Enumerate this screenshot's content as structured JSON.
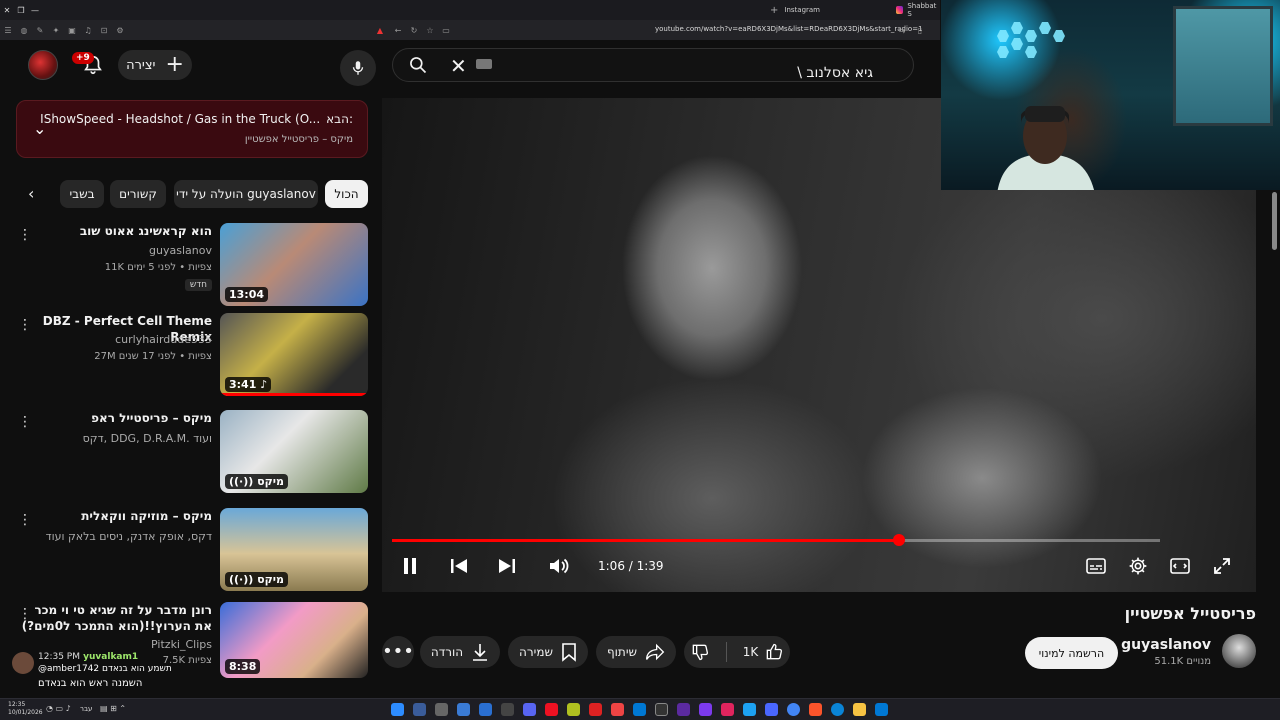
{
  "browser": {
    "tabs": [
      {
        "label": "Instagram"
      },
      {
        "label": "Shabbat S"
      }
    ],
    "url": "youtube.com/watch?v=eaRD6X3DjMs&list=RDeaRD6X3DjMs&start_radio=1"
  },
  "header": {
    "notification_count": "+9",
    "create_label": "יצירה",
    "search_query": "גיא אסלנוב \\"
  },
  "up_next": {
    "title": "IShowSpeed - Headshot / Gas in the Truck (O...",
    "prefix": "הבא:",
    "subtitle": "מיקס – פריסטייל אפשטיין"
  },
  "chips": [
    "הכול",
    "הועלה על ידי guyaslanov",
    "קשורים",
    "בשבי"
  ],
  "videos": [
    {
      "title": "הוא קראשינג אאוט שוב",
      "channel": "guyaslanov",
      "meta": "11K צפיות • לפני 5 ימים",
      "badge": "חדש",
      "duration": "13:04"
    },
    {
      "title": "DBZ - Perfect Cell Theme Remix",
      "channel": "curlyhairdude535",
      "meta": "27M צפיות • לפני 17 שנים",
      "duration": "3:41"
    },
    {
      "title": "מיקס – פריסטייל ראפ",
      "channel": "דקס, DDG, D.R.A.M. ועוד",
      "duration": "מיקס"
    },
    {
      "title": "מיקס – מוזיקה ווקאלית",
      "channel": "דקס, אופק אדנק, ניסים בלאק ועוד",
      "duration": "מיקס"
    },
    {
      "title": "רונן מדבר על זה שגיא טי וי מכר את הערוץ!!(הוא התמכר ל0מים?)",
      "channel": "Pitzki_Clips",
      "meta": "7.5K צפיות",
      "duration": "8:38"
    }
  ],
  "player": {
    "current_time": "1:06",
    "total_time": "1:39",
    "time_display": "1:06 / 1:39",
    "progress_fraction": 0.66
  },
  "video": {
    "title": "פריסטייל אפשטיין",
    "channel": "guyaslanov",
    "subscribers": "51.1K מנויים",
    "subscribe_label": "הרשמה למינוי",
    "likes": "1K",
    "share_label": "שיתוף",
    "save_label": "שמירה",
    "download_label": "הורדה"
  },
  "chat": {
    "time": "12:35 PM",
    "user": "yuvalkam1",
    "line2": "@amber1742 תשמע הוא בנאדם",
    "line3": "השמנה ראש הוא בנאדם"
  },
  "taskbar": {
    "time": "12:35",
    "date": "10/01/2026",
    "lang": "עבר"
  }
}
